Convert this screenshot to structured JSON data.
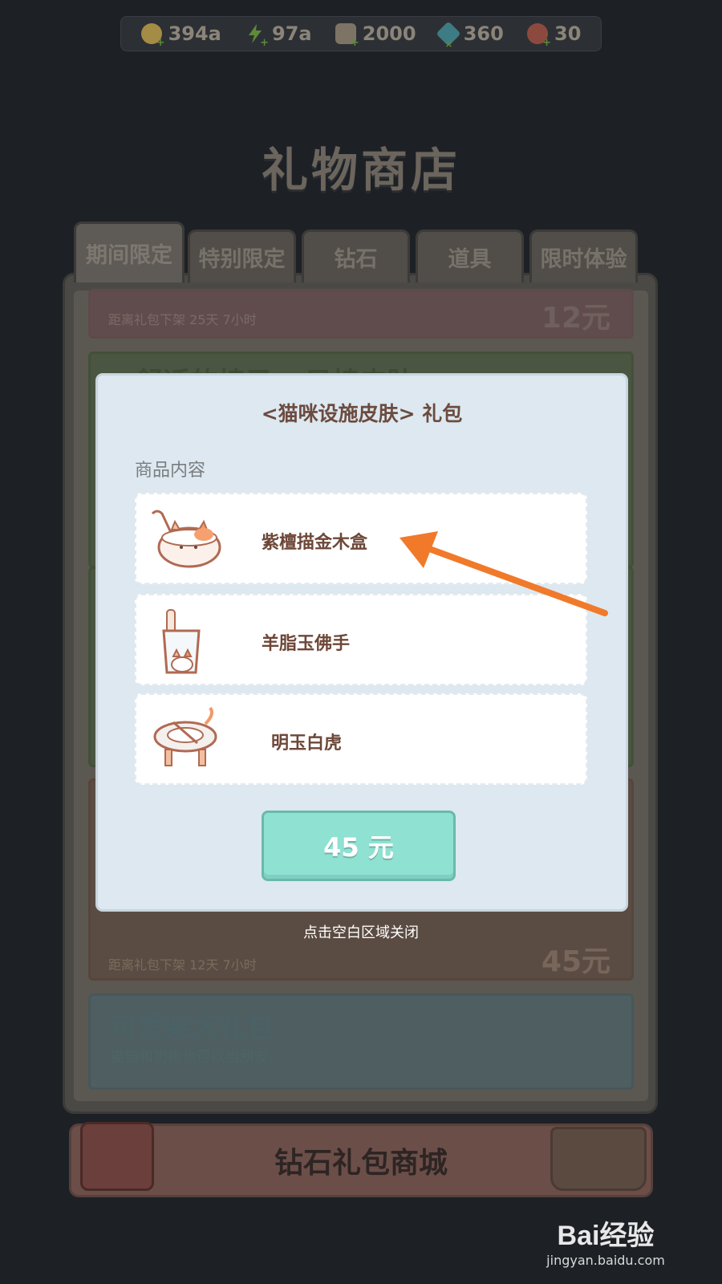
{
  "resources": [
    {
      "name": "coin",
      "value": "394a"
    },
    {
      "name": "energy",
      "value": "97a"
    },
    {
      "name": "can",
      "value": "2000"
    },
    {
      "name": "diamond",
      "value": "360"
    },
    {
      "name": "ticket",
      "value": "30"
    }
  ],
  "shop_title": "礼物商店",
  "tabs": [
    "期间限定",
    "特别限定",
    "钻石",
    "道具",
    "限时体验"
  ],
  "cards": {
    "card1": {
      "timer": "距离礼包下架 25天 7小时",
      "price": "12元"
    },
    "card2": {
      "title": "<舒适的椅子> 目椅皮肤"
    },
    "card4": {
      "timer": "距离礼包下架 12天 7小时",
      "price": "45元"
    },
    "card5": {
      "title": "可爱柴犬礼包",
      "subtitle": "猫猫和狗狗也可以当朋友。"
    }
  },
  "bottom_button": "钻石礼包商城",
  "modal": {
    "title": "<猫咪设施皮肤> 礼包",
    "section_label": "商品内容",
    "items": [
      {
        "name": "紫檀描金木盒"
      },
      {
        "name": "羊脂玉佛手"
      },
      {
        "name": "明玉白虎"
      }
    ],
    "price": "45 元"
  },
  "close_hint": "点击空白区域关闭",
  "watermark": {
    "logo": "Bai经验",
    "url": "jingyan.baidu.com"
  },
  "colors": {
    "background": "#1d2126",
    "modal_bg": "#dde8f0",
    "price_button": "#8fe1d2",
    "item_text": "#6d4738",
    "annotation_arrow": "#f07a2a"
  }
}
